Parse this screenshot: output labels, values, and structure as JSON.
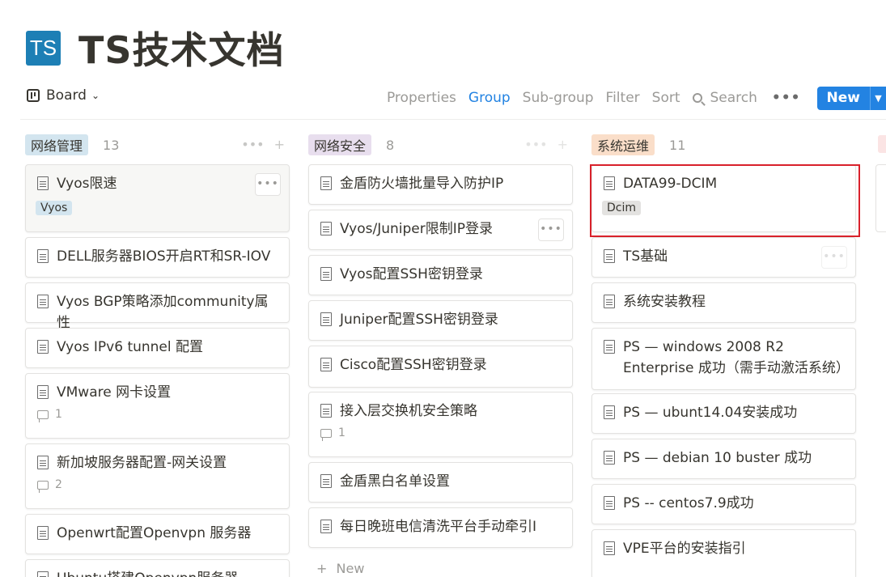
{
  "page": {
    "logo_text": "TS",
    "title": "TS技术文档"
  },
  "toolbar": {
    "view_label": "Board",
    "properties": "Properties",
    "group": "Group",
    "subgroup": "Sub-group",
    "filter": "Filter",
    "sort": "Sort",
    "search": "Search",
    "more": "•••",
    "new_label": "New"
  },
  "colors": {
    "accent": "#2383e2",
    "tag_network_mgmt": "#d3e5ef",
    "tag_network_sec": "#e8deee",
    "tag_ops": "#fadec9",
    "tag_gray": "#e3e2e0",
    "highlight": "#d9212b"
  },
  "columns": [
    {
      "name": "网络管理",
      "count": "13",
      "cards": [
        {
          "title": "Vyos限速",
          "tag": "Vyos"
        },
        {
          "title": "DELL服务器BIOS开启RT和SR-IOV"
        },
        {
          "title": "Vyos BGP策略添加community属性"
        },
        {
          "title": "Vyos IPv6 tunnel 配置"
        },
        {
          "title": "VMware 网卡设置",
          "comments": "1"
        },
        {
          "title": "新加坡服务器配置-网关设置",
          "comments": "2"
        },
        {
          "title": "Openwrt配置Openvpn 服务器"
        },
        {
          "title": "Ubuntu搭建Openvpn服务器"
        }
      ]
    },
    {
      "name": "网络安全",
      "count": "8",
      "new_label": "New",
      "cards": [
        {
          "title": "金盾防火墙批量导入防护IP"
        },
        {
          "title": "Vyos/Juniper限制IP登录"
        },
        {
          "title": "Vyos配置SSH密钥登录"
        },
        {
          "title": "Juniper配置SSH密钥登录"
        },
        {
          "title": "Cisco配置SSH密钥登录"
        },
        {
          "title": "接入层交换机安全策略",
          "comments": "1"
        },
        {
          "title": "金盾黑白名单设置"
        },
        {
          "title": "每日晚班电信清洗平台手动牵引I"
        }
      ]
    },
    {
      "name": "系统运维",
      "count": "11",
      "cards": [
        {
          "title": "DATA99-DCIM",
          "tag": "Dcim"
        },
        {
          "title": "TS基础"
        },
        {
          "title": "系统安装教程"
        },
        {
          "title": "PS — windows 2008 R2 Enterprise 成功（需手动激活系统）"
        },
        {
          "title": "PS — ubunt14.04安装成功"
        },
        {
          "title": "PS — debian 10 buster 成功"
        },
        {
          "title": "PS -- centos7.9成功"
        },
        {
          "title": "VPE平台的安装指引"
        }
      ]
    }
  ]
}
